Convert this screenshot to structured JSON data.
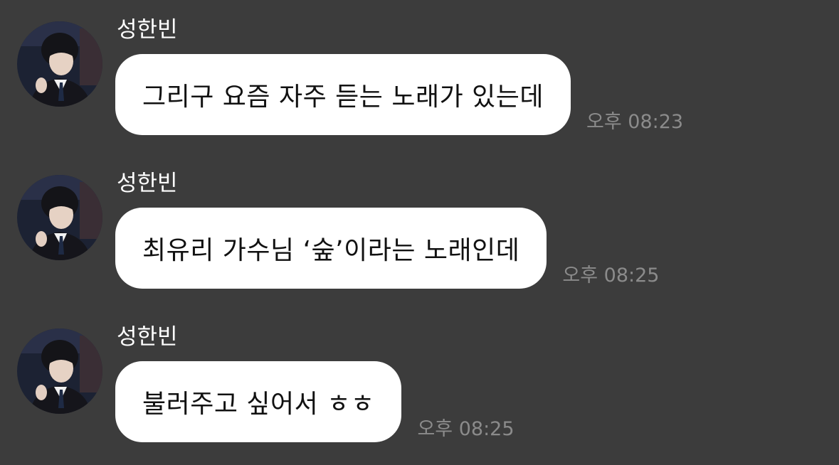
{
  "messages": [
    {
      "sender": "성한빈",
      "text": "그리구 요즘 자주 듣는 노래가 있는데",
      "time": "오후 08:23"
    },
    {
      "sender": "성한빈",
      "text": "최유리 가수님 ‘숲’이라는 노래인데",
      "time": "오후 08:25"
    },
    {
      "sender": "성한빈",
      "text": "불러주고 싶어서 ㅎㅎ",
      "time": "오후 08:25"
    }
  ],
  "colors": {
    "background": "#3c3c3c",
    "bubble": "#ffffff",
    "sender_text": "#ffffff",
    "message_text": "#111111",
    "timestamp": "#8b8b8b"
  },
  "icons": {
    "avatar": "profile-photo"
  }
}
